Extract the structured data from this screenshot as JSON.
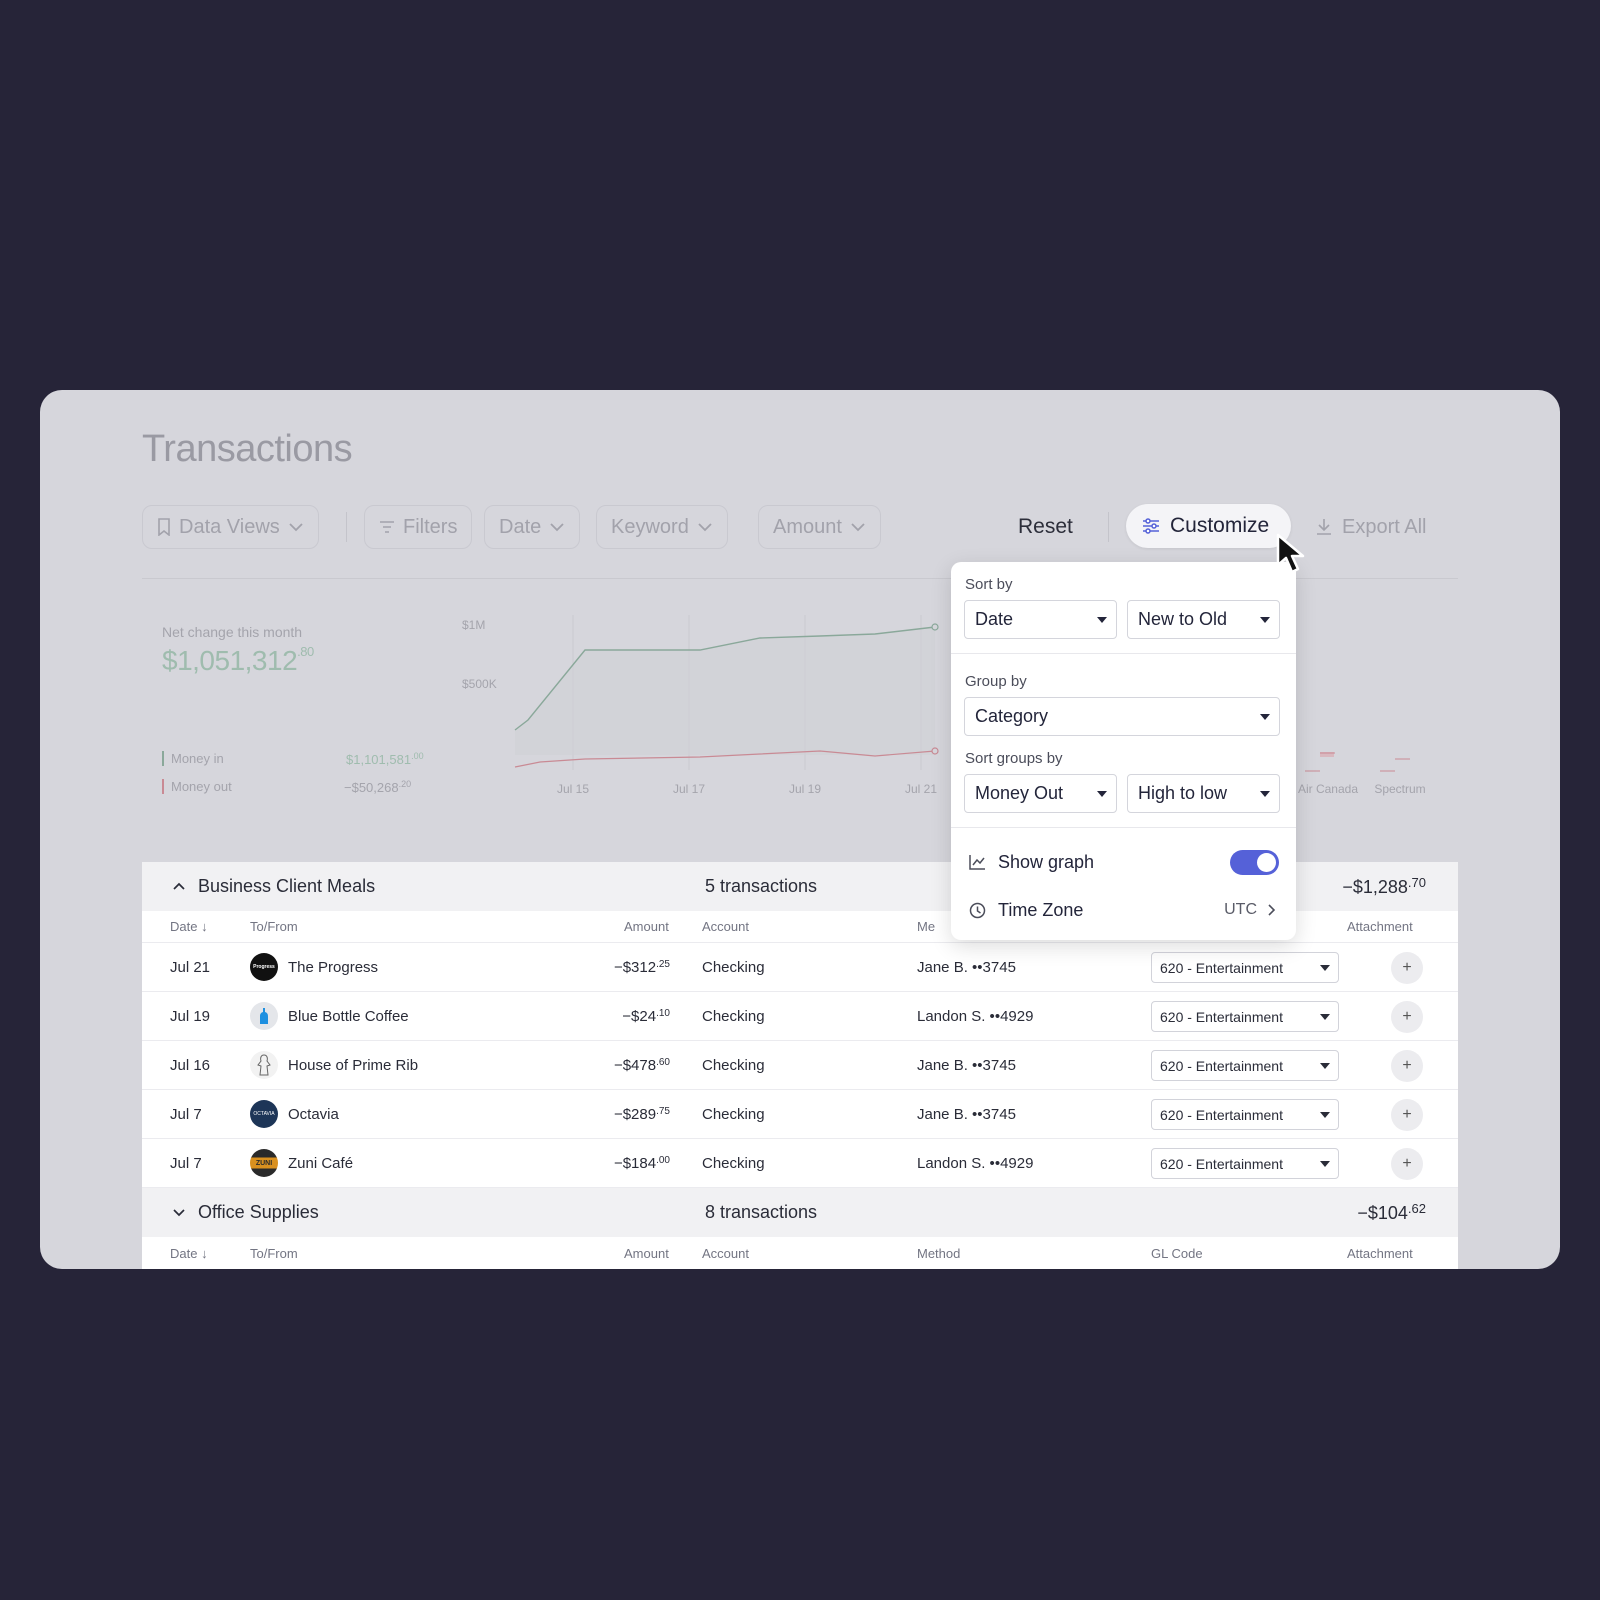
{
  "title": "Transactions",
  "toolbar": {
    "data_views": "Data Views",
    "filters": "Filters",
    "date": "Date",
    "keyword": "Keyword",
    "amount": "Amount",
    "reset": "Reset",
    "customize": "Customize",
    "export_all": "Export All"
  },
  "summary": {
    "net_label": "Net change this month",
    "net_value": "$1,051,312",
    "net_cents": ".80",
    "money_in_label": "Money in",
    "money_in_value": "$1,101,581",
    "money_in_cents": ".00",
    "money_out_label": "Money out",
    "money_out_value": "−$50,268",
    "money_out_cents": ".20"
  },
  "chart_data": {
    "type": "line",
    "y_ticks": [
      "$1M",
      "$500K"
    ],
    "x_ticks": [
      "Jul 15",
      "Jul 17",
      "Jul 19",
      "Jul 21"
    ],
    "series": [
      {
        "name": "Money in",
        "color": "#8aa89a"
      },
      {
        "name": "Money out",
        "color": "#c98a94"
      }
    ],
    "bar_labels": [
      "Air Canada",
      "Spectrum"
    ]
  },
  "popover": {
    "sort_by_label": "Sort by",
    "sort_by_field": "Date",
    "sort_by_order": "New to Old",
    "group_by_label": "Group by",
    "group_by_value": "Category",
    "sort_groups_label": "Sort groups by",
    "sort_groups_field": "Money Out",
    "sort_groups_order": "High to low",
    "show_graph_label": "Show graph",
    "show_graph_on": true,
    "time_zone_label": "Time Zone",
    "time_zone_value": "UTC"
  },
  "columns": {
    "date": "Date",
    "to_from": "To/From",
    "amount": "Amount",
    "account": "Account",
    "method": "Method",
    "method_partial": "Me",
    "gl_code": "GL Code",
    "attachment": "Attachment"
  },
  "groups": [
    {
      "name": "Business Client Meals",
      "count": "5 transactions",
      "total": "−$1,288",
      "total_cents": ".70",
      "rows": [
        {
          "date": "Jul 21",
          "name": "The Progress",
          "amount": "−$312",
          "cents": ".25",
          "account": "Checking",
          "method": "Jane B. ••3745",
          "gl": "620 - Entertainment",
          "avatar_text": "Progress",
          "avatar_color": "#111111"
        },
        {
          "date": "Jul 19",
          "name": "Blue Bottle Coffee",
          "amount": "−$24",
          "cents": ".10",
          "account": "Checking",
          "method": "Landon S. ••4929",
          "gl": "620 - Entertainment",
          "avatar_text": "",
          "avatar_color": "#e4e6ea"
        },
        {
          "date": "Jul 16",
          "name": "House of Prime Rib",
          "amount": "−$478",
          "cents": ".60",
          "account": "Checking",
          "method": "Jane B. ••3745",
          "gl": "620 - Entertainment",
          "avatar_text": "",
          "avatar_color": "#f2f2f2"
        },
        {
          "date": "Jul 7",
          "name": "Octavia",
          "amount": "−$289",
          "cents": ".75",
          "account": "Checking",
          "method": "Jane B. ••3745",
          "gl": "620 - Entertainment",
          "avatar_text": "OCTAVIA",
          "avatar_color": "#1d3557"
        },
        {
          "date": "Jul 7",
          "name": "Zuni Café",
          "amount": "−$184",
          "cents": ".00",
          "account": "Checking",
          "method": "Landon S. ••4929",
          "gl": "620 - Entertainment",
          "avatar_text": "ZUNI",
          "avatar_color": "#c8861a"
        }
      ]
    },
    {
      "name": "Office Supplies",
      "count": "8 transactions",
      "total": "−$104",
      "total_cents": ".62"
    }
  ]
}
